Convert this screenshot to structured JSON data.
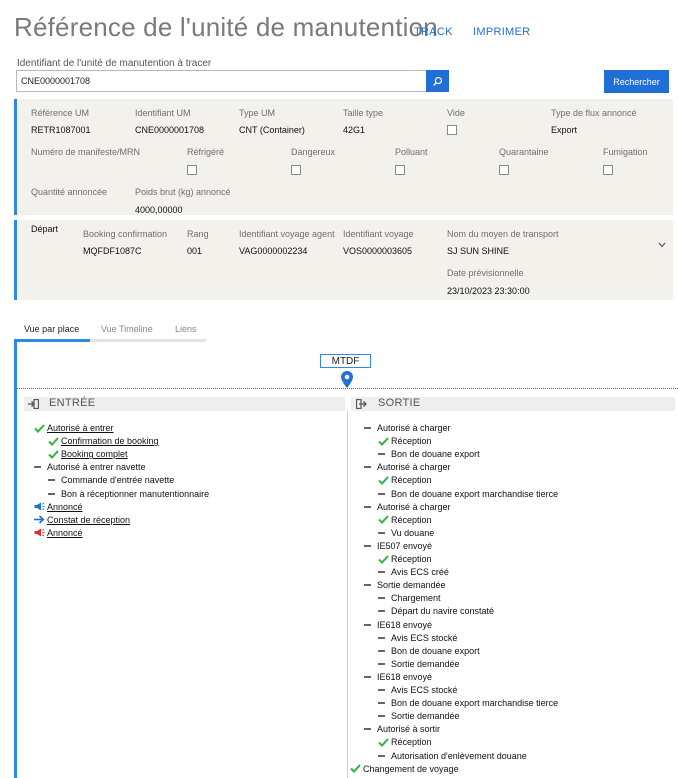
{
  "header": {
    "title": "Référence de l'unité de manutention",
    "track": "TRACK",
    "print": "IMPRIMER"
  },
  "search": {
    "label": "Identifiant de l'unité de manutention à tracer",
    "value": "CNE0000001708",
    "button": "Rechercher",
    "icon": "search-icon"
  },
  "unit": {
    "fields": [
      {
        "label": "Référence UM",
        "value": "RETR1087001"
      },
      {
        "label": "Identifiant UM",
        "value": "CNE0000001708"
      },
      {
        "label": "Type UM",
        "value": "CNT (Container)"
      },
      {
        "label": "Taille type",
        "value": "42G1"
      },
      {
        "label": "Vide",
        "value": ""
      },
      {
        "label": "Type de flux annoncé",
        "value": "Export"
      }
    ],
    "flags": [
      {
        "label": "Numéro de manifeste/MRN",
        "value": ""
      },
      {
        "label": "Réfrigéré",
        "value": ""
      },
      {
        "label": "Dangereux",
        "value": ""
      },
      {
        "label": "Polluant",
        "value": ""
      },
      {
        "label": "Quarantaine",
        "value": ""
      },
      {
        "label": "Fumigation",
        "value": ""
      }
    ],
    "qty_label": "Quantité annoncée",
    "weight_label": "Poids brut (kg) annoncé",
    "weight_value": "4000,00000"
  },
  "departure": {
    "title": "Départ",
    "booking_label": "Booking confirmation",
    "booking_value": "MQFDF1087C",
    "rank_label": "Rang",
    "rank_value": "001",
    "agent_voyage_label": "Identifiant voyage agent",
    "agent_voyage_value": "VAG0000002234",
    "voyage_label": "Identifiant voyage",
    "voyage_value": "VOS0000003605",
    "transport_label": "Nom du moyen de transport",
    "transport_value": "SJ SUN SHINE",
    "date_label": "Date prévisionnelle",
    "date_value": "23/10/2023 23:30:00"
  },
  "tabs": [
    "Vue par place",
    "Vue Timeline",
    "Liens"
  ],
  "place": "MTDF",
  "entry": {
    "title": "ENTRÉE",
    "items": [
      {
        "text": "Autorisé à entrer",
        "icon": "check",
        "level": 0,
        "link": true
      },
      {
        "text": "Confirmation de booking",
        "icon": "check",
        "level": 1,
        "link": true
      },
      {
        "text": "Booking complet",
        "icon": "check",
        "level": 1,
        "link": true
      },
      {
        "text": "Autorisé à entrer navette",
        "icon": "dash",
        "level": 0,
        "link": false
      },
      {
        "text": "Commande d'entrée navette",
        "icon": "dash",
        "level": 1,
        "link": false
      },
      {
        "text": "Bon à réceptionner manutentionnaire",
        "icon": "dash",
        "level": 1,
        "link": false
      },
      {
        "text": "Annoncé",
        "icon": "megaphone-blue",
        "level": 0,
        "link": true
      },
      {
        "text": "Constat de réception",
        "icon": "arrow-in",
        "level": 0,
        "link": true
      },
      {
        "text": "Annoncé",
        "icon": "megaphone-red",
        "level": 0,
        "link": true
      }
    ]
  },
  "exit": {
    "title": "SORTIE",
    "items": [
      {
        "text": "Autorisé à charger",
        "icon": "dash",
        "level": 0
      },
      {
        "text": "Réception",
        "icon": "check",
        "level": 1
      },
      {
        "text": "Bon de douane export",
        "icon": "dash",
        "level": 1
      },
      {
        "text": "Autorisé à charger",
        "icon": "dash",
        "level": 0
      },
      {
        "text": "Réception",
        "icon": "check",
        "level": 1
      },
      {
        "text": "Bon de douane export marchandise tierce",
        "icon": "dash",
        "level": 1
      },
      {
        "text": "Autorisé à charger",
        "icon": "dash",
        "level": 0
      },
      {
        "text": "Réception",
        "icon": "check",
        "level": 1
      },
      {
        "text": "Vu douane",
        "icon": "dash",
        "level": 1
      },
      {
        "text": "IE507 envoyé",
        "icon": "dash",
        "level": 0
      },
      {
        "text": "Réception",
        "icon": "check",
        "level": 1
      },
      {
        "text": "Avis ECS créé",
        "icon": "dash",
        "level": 1
      },
      {
        "text": "Sortie demandée",
        "icon": "dash",
        "level": 0
      },
      {
        "text": "Chargement",
        "icon": "dash",
        "level": 1
      },
      {
        "text": "Départ du navire constaté",
        "icon": "dash",
        "level": 1
      },
      {
        "text": "IE618 envoyé",
        "icon": "dash",
        "level": 0
      },
      {
        "text": "Avis ECS stocké",
        "icon": "dash",
        "level": 1
      },
      {
        "text": "Bon de douane export",
        "icon": "dash",
        "level": 1
      },
      {
        "text": "Sortie demandée",
        "icon": "dash",
        "level": 1
      },
      {
        "text": "IE618 envoyé",
        "icon": "dash",
        "level": 0
      },
      {
        "text": "Avis ECS stocké",
        "icon": "dash",
        "level": 1
      },
      {
        "text": "Bon de douane export marchandise tierce",
        "icon": "dash",
        "level": 1
      },
      {
        "text": "Sortie demandée",
        "icon": "dash",
        "level": 1
      },
      {
        "text": "Autorisé à sortir",
        "icon": "dash",
        "level": 0
      },
      {
        "text": "Réception",
        "icon": "check",
        "level": 1
      },
      {
        "text": "Autorisation d'enlèvement douane",
        "icon": "dash",
        "level": 1
      },
      {
        "text": "Changement de voyage",
        "icon": "check",
        "level": -1
      }
    ]
  },
  "colors": {
    "accent": "#1f6fd6",
    "bar": "#2e8ae6",
    "check": "#2fb344",
    "alert": "#e03030"
  }
}
